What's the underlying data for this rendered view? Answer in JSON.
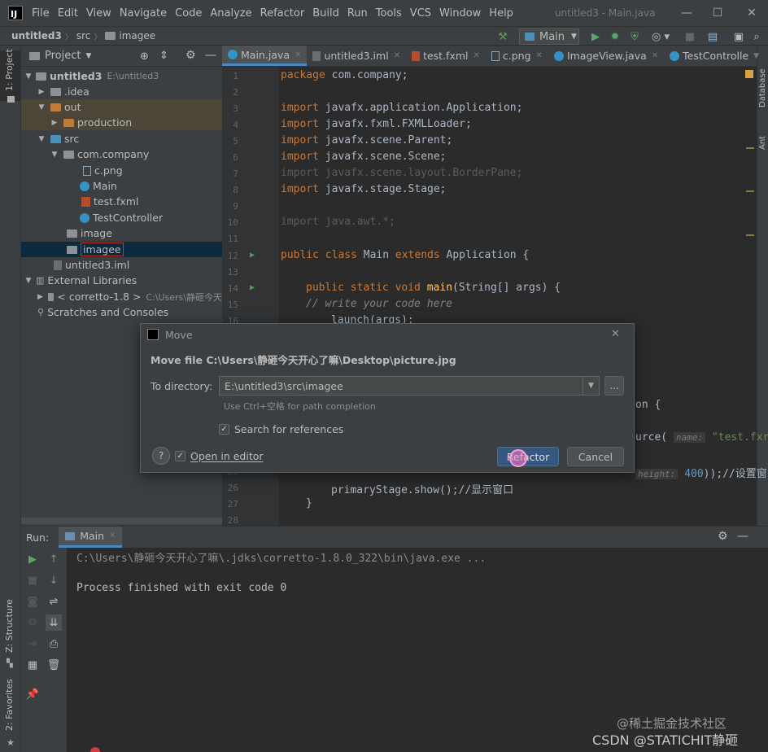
{
  "menubar": {
    "items": [
      "File",
      "Edit",
      "View",
      "Navigate",
      "Code",
      "Analyze",
      "Refactor",
      "Build",
      "Run",
      "Tools",
      "VCS",
      "Window",
      "Help"
    ],
    "window_title": "untitled3 - Main.java"
  },
  "navbar": {
    "crumbs": [
      "untitled3",
      "src",
      "imagee"
    ],
    "run_config": "Main"
  },
  "leftstrip": {
    "project_label": "1: Project",
    "structure_label": "Z: Structure",
    "favorites_label": "2: Favorites"
  },
  "rightstrip": {
    "database_label": "Database",
    "ant_label": "Ant"
  },
  "project": {
    "title": "Project",
    "tree": [
      {
        "label": "untitled3",
        "suffix": "E:\\untitled3"
      },
      {
        "label": ".idea"
      },
      {
        "label": "out"
      },
      {
        "label": "production"
      },
      {
        "label": "src"
      },
      {
        "label": "com.company"
      },
      {
        "label": "c.png"
      },
      {
        "label": "Main"
      },
      {
        "label": "test.fxml"
      },
      {
        "label": "TestController"
      },
      {
        "label": "image"
      },
      {
        "label": "imagee"
      },
      {
        "label": "untitled3.iml"
      },
      {
        "label": "External Libraries"
      },
      {
        "label": "< corretto-1.8 >",
        "suffix": "C:\\Users\\静砸今天"
      },
      {
        "label": "Scratches and Consoles"
      }
    ]
  },
  "tabs": [
    "Main.java",
    "untitled3.iml",
    "test.fxml",
    "c.png",
    "ImageView.java",
    "TestControlle"
  ],
  "code": {
    "line_numbers": [
      "1",
      "2",
      "3",
      "4",
      "5",
      "6",
      "7",
      "8",
      "9",
      "10",
      "11",
      "12",
      "13",
      "14",
      "15",
      "16",
      "17",
      "18",
      "19",
      "20",
      "21",
      "22",
      "23",
      "24",
      "25",
      "26",
      "27",
      "28"
    ],
    "lines": {
      "l1_kw": "package",
      "l1_rest": " com.company;",
      "l3_kw": "import",
      "l3_rest": " javafx.application.Application;",
      "l4_kw": "import",
      "l4_rest": " javafx.fxml.FXMLLoader;",
      "l5_kw": "import",
      "l5_rest": " javafx.scene.Parent;",
      "l6_kw": "import",
      "l6_rest": " javafx.scene.Scene;",
      "l7": "import javafx.scene.layout.BorderPane;",
      "l8_kw": "import",
      "l8_rest": " javafx.stage.Stage;",
      "l10": "import java.awt.*;",
      "l12_kw1": "public class",
      "l12_name": " Main ",
      "l12_kw2": "extends",
      "l12_rest": " Application {",
      "l14_kw": "public static void",
      "l14_fn": " main",
      "l14_rest": "(String[] args) {",
      "l15": "// write your code here",
      "l16": "launch(args);",
      "l19_rest": "on {",
      "l22_rest": "urce(",
      "l22_hint": "name:",
      "l22_str": "\"test.fxr",
      "l25_hint": "height:",
      "l25_num": "400",
      "l25_rest": "));//设置窗口",
      "l26": "primaryStage.show();//显示窗口",
      "l27": "}"
    }
  },
  "dialog": {
    "title": "Move",
    "heading": "Move file C:\\Users\\静砸今天开心了嘛\\Desktop\\picture.jpg",
    "to_directory_label": "To directory:",
    "to_directory_value": "E:\\untitled3\\src\\imagee",
    "hint": "Use Ctrl+空格 for path completion",
    "search_refs_label": "Search for references",
    "open_in_editor_label": "Open in editor",
    "refactor_label": "Refactor",
    "cancel_label": "Cancel",
    "browse_label": "..."
  },
  "run": {
    "label": "Run:",
    "tab": "Main",
    "output": [
      "C:\\Users\\静砸今天开心了嘛\\.jdks\\corretto-1.8.0_322\\bin\\java.exe ...",
      "",
      "Process finished with exit code 0"
    ]
  },
  "watermark": {
    "line1": "@稀土掘金技术社区",
    "line2": "CSDN @STATICHIT静砸"
  }
}
